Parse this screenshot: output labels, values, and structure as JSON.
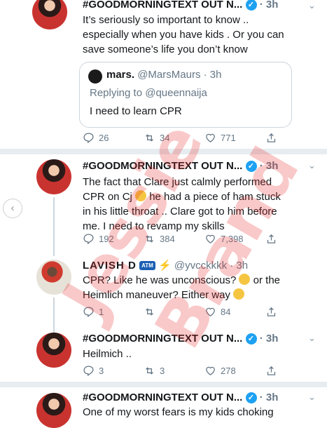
{
  "tweet1": {
    "name": "#GOODMORNINGTEXT OUT N...",
    "time": "· 3h",
    "text_line1": "It’s seriously so important to know ..",
    "text_line2": "especially when you have kids . Or you can",
    "text_line3": "save someone’s life you don’t know",
    "quote": {
      "name": "mars.",
      "handle_time": "@MarsMaurs · 3h",
      "replying": "Replying to @queennaija",
      "text": "I need to learn CPR"
    },
    "replies": "26",
    "retweets": "34",
    "likes": "771"
  },
  "tweet2": {
    "name": "#GOODMORNINGTEXT OUT N...",
    "time": "· 3h",
    "text_line1": "The fact that Clare just calmly performed",
    "text_line2_a": "CPR on Cj",
    "text_line2_b": "he had a piece of ham stuck",
    "text_line3": "in his little throat .. Clare got to him before",
    "text_line4": "me. I need to revamp my skills",
    "replies": "192",
    "retweets": "384",
    "likes": "7,398"
  },
  "tweet3": {
    "name": "LAVISH D",
    "badge": "ATM",
    "handle_time": "@yvcckkkk · 3h",
    "text_line1_a": "CPR? Like he was unconscious?",
    "text_line1_b": "or the",
    "text_line2_a": "Heimlich maneuver? Either way",
    "replies": "1",
    "retweets": "",
    "likes": "84"
  },
  "tweet4": {
    "name": "#GOODMORNINGTEXT OUT N...",
    "time": "· 3h",
    "text_line1": "Heilmich ..",
    "replies": "3",
    "retweets": "3",
    "likes": "278"
  },
  "tweet5": {
    "name": "#GOODMORNINGTEXT OUT N...",
    "time": "· 3h",
    "text_line1": "One of my worst fears is my kids choking"
  },
  "watermark": {
    "line1": "Jessie",
    "line2": "Brand"
  },
  "colors": {
    "verified": "#1da1f2",
    "secondary_text": "#657786",
    "divider": "#e6ecf0"
  }
}
